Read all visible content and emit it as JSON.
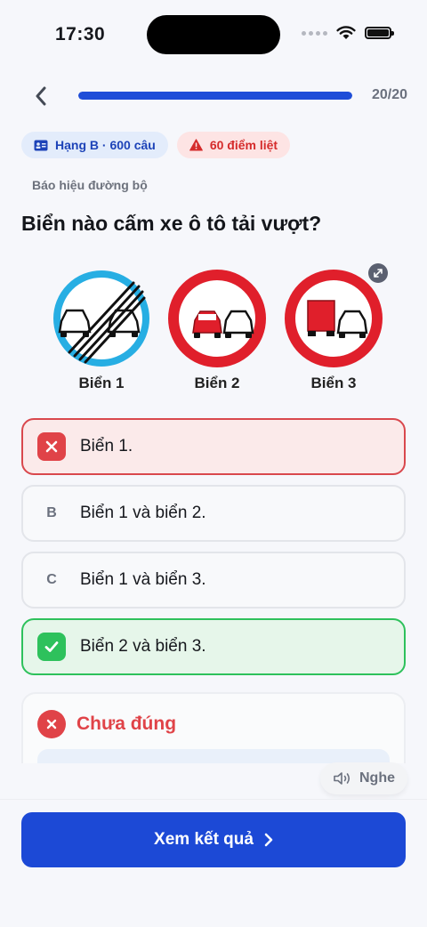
{
  "status_bar": {
    "time": "17:30"
  },
  "header": {
    "progress_text": "20/20",
    "progress_fraction": 1.0
  },
  "badges": {
    "license": {
      "label": "Hạng B · 600 câu",
      "icon": "id-card-icon"
    },
    "fail_points": {
      "label": "60 điểm liệt",
      "icon": "warning-icon"
    }
  },
  "question": {
    "category": "Báo hiệu đường bộ",
    "text": "Biển nào cấm xe ô tô tải vượt?"
  },
  "sign_image": {
    "labels": [
      "Biển 1",
      "Biển 2",
      "Biển 3"
    ]
  },
  "answers": [
    {
      "marker": "",
      "text": "Biển 1.",
      "state": "wrong"
    },
    {
      "marker": "B",
      "text": "Biển 1 và biển 2.",
      "state": "normal"
    },
    {
      "marker": "C",
      "text": "Biển 1 và biển 3.",
      "state": "normal"
    },
    {
      "marker": "",
      "text": "Biển 2 và biển 3.",
      "state": "correct"
    }
  ],
  "result": {
    "title": "Chưa đúng"
  },
  "listen": {
    "label": "Nghe"
  },
  "primary_action": {
    "label": "Xem kết quả"
  },
  "colors": {
    "primary": "#1c49d6",
    "wrong": "#e04348",
    "correct": "#2ec15c"
  }
}
